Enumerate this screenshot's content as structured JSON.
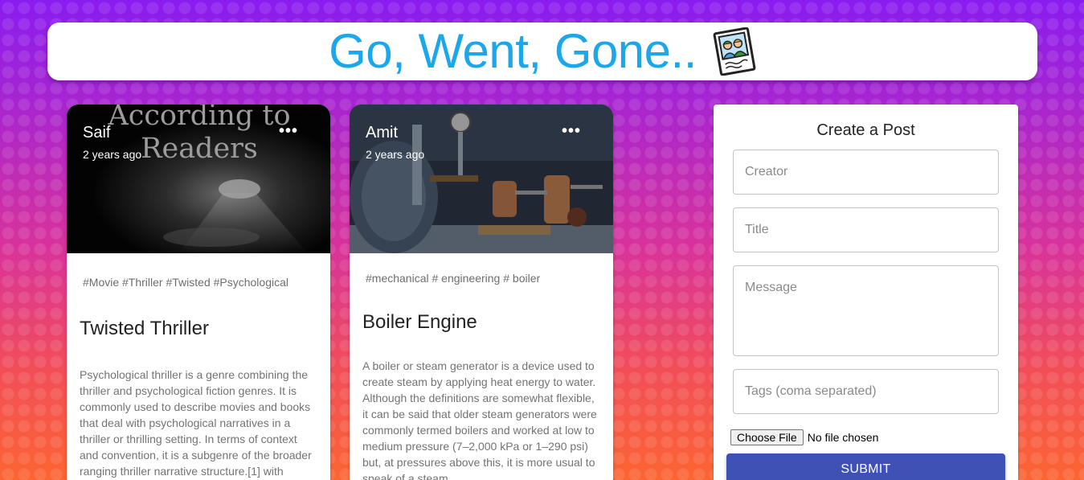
{
  "header": {
    "title": "Go, Went, Gone..",
    "logo_icon": "polaroid-photo-icon"
  },
  "posts": [
    {
      "creator": "Saif",
      "time": "2 years ago",
      "image_text": "According to Readers",
      "tags": "#Movie #Thriller #Twisted #Psychological",
      "title": "Twisted Thriller",
      "message": "Psychological thriller is a genre combining the thriller and psychological fiction genres. It is commonly used to describe movies and books that deal with psychological narratives in a thriller or thrilling setting. In terms of context and convention, it is a subgenre of the broader ranging thriller narrative structure.[1] with similarities to Gothic and detective fiction in"
    },
    {
      "creator": "Amit",
      "time": "2 years ago",
      "tags": "#mechanical # engineering # boiler",
      "title": "Boiler Engine",
      "message": "A boiler or steam generator is a device used to create steam by applying heat energy to water. Although the definitions are somewhat flexible, it can be said that older steam generators were commonly termed boilers and worked at low to medium pressure (7–2,000 kPa or 1–290 psi) but, at pressures above this, it is more usual to speak of a steam"
    }
  ],
  "form": {
    "heading": "Create a Post",
    "creator_placeholder": "Creator",
    "title_placeholder": "Title",
    "message_placeholder": "Message",
    "tags_placeholder": "Tags (coma separated)",
    "file_button": "Choose File",
    "file_status": "No file chosen",
    "submit_label": "SUBMIT"
  },
  "colors": {
    "title": "#1aa7ec",
    "submit": "#3f51b5"
  }
}
